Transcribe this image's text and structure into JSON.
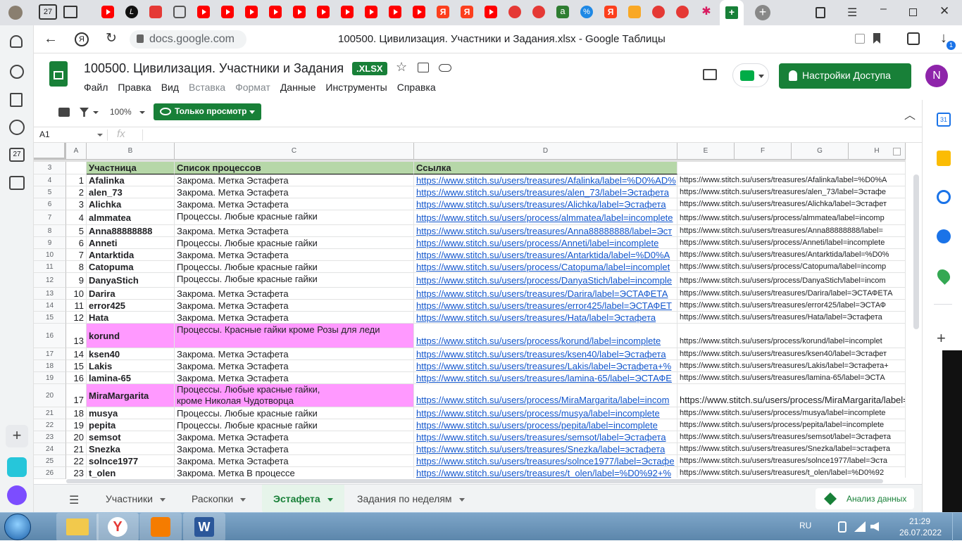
{
  "browser": {
    "tab_count_badge": "27",
    "address": "docs.google.com",
    "page_title": "100500. Цивилизация. Участники и Задания.xlsx - Google Таблицы",
    "download_badge": "1"
  },
  "doc": {
    "title": "100500. Цивилизация. Участники и Задания",
    "badge": ".XLSX",
    "menus": [
      "Файл",
      "Правка",
      "Вид",
      "Вставка",
      "Формат",
      "Данные",
      "Инструменты",
      "Справка"
    ],
    "share_label": "Настройки Доступа",
    "avatar_letter": "N",
    "colors": {
      "brand_green": "#188038",
      "link": "#1155cc",
      "header_fill": "#b6d7a8",
      "pink_fill": "#ff99ff",
      "avatar": "#8e24aa"
    }
  },
  "toolbar": {
    "zoom": "100%",
    "view_only_label": "Только просмотр",
    "cell_ref": "A1",
    "fx": "fx"
  },
  "grid": {
    "columns": [
      "A",
      "B",
      "C",
      "D",
      "E",
      "F",
      "G",
      "H"
    ],
    "header_row": {
      "num": "3",
      "b": "Участница",
      "c": "Список процессов",
      "d": "Ссылка"
    },
    "rows": [
      {
        "num": "4",
        "a": "1",
        "b": "Afalinka",
        "c": "Закрома. Метка Эстафета",
        "d": "https://www.stitch.su/users/treasures/Afalinka/label=%D0%AD%",
        "e": "https://www.stitch.su/users/treasures/Afalinka/label=%D0%A"
      },
      {
        "num": "5",
        "a": "2",
        "b": "alen_73",
        "c": "Закрома. Метка Эстафета",
        "d": "https://www.stitch.su/users/treasures/alen_73/label=Эстафета",
        "e": "https://www.stitch.su/users/treasures/alen_73/label=Эстафе"
      },
      {
        "num": "6",
        "a": "3",
        "b": "Alichka",
        "c": "Закрома. Метка Эстафета",
        "d": "https://www.stitch.su/users/treasures/Alichka/label=Эстафета",
        "e": "https://www.stitch.su/users/treasures/Alichka/label=Эстафет"
      },
      {
        "num": "7",
        "a": "4",
        "b": "almmatea",
        "c": "Процессы. Любые красные гайки",
        "d": "https://www.stitch.su/users/process/almmatea/label=incomplete",
        "e": "https://www.stitch.su/users/process/almmatea/label=incomp"
      },
      {
        "num": "8",
        "a": "5",
        "b": "Anna88888888",
        "c": "Закрома. Метка Эстафета",
        "d": "https://www.stitch.su/users/treasures/Anna88888888/label=Эст",
        "e": "https://www.stitch.su/users/treasures/Anna88888888/label="
      },
      {
        "num": "9",
        "a": "6",
        "b": "Anneti",
        "c": "Процессы. Любые красные гайки",
        "d": "https://www.stitch.su/users/process/Anneti/label=incomplete",
        "e": "https://www.stitch.su/users/process/Anneti/label=incomplete"
      },
      {
        "num": "10",
        "a": "7",
        "b": "Antarktida",
        "c": "Закрома. Метка Эстафета",
        "d": "https://www.stitch.su/users/treasures/Antarktida/label=%D0%A",
        "e": "https://www.stitch.su/users/treasures/Antarktida/label=%D0%"
      },
      {
        "num": "11",
        "a": "8",
        "b": "Catopuma",
        "c": "Процессы. Любые красные гайки",
        "d": "https://www.stitch.su/users/process/Catopuma/label=incomplet",
        "e": "https://www.stitch.su/users/process/Catopuma/label=incomp"
      },
      {
        "num": "12",
        "a": "9",
        "b": "DanyaStich",
        "c": "Процессы. Любые красные гайки",
        "d": "https://www.stitch.su/users/process/DanyaStich/label=incomple",
        "e": "https://www.stitch.su/users/process/DanyaStich/label=incom"
      },
      {
        "num": "13",
        "a": "10",
        "b": "Darira",
        "c": "Закрома. Метка Эстафета",
        "d": "https://www.stitch.su/users/treasures/Darira/label=ЭСТАФЕТА",
        "e": "https://www.stitch.su/users/treasures/Darira/label=ЭСТАФЕТА"
      },
      {
        "num": "14",
        "a": "11",
        "b": "error425",
        "c": "Закрома. Метка Эстафета",
        "d": "https://www.stitch.su/users/treasures/error425/label=ЭСТАФЕТ",
        "e": "https://www.stitch.su/users/treasures/error425/label=ЭСТАФ"
      },
      {
        "num": "15",
        "a": "12",
        "b": "Hata",
        "c": "Закрома. Метка Эстафета",
        "d": "https://www.stitch.su/users/treasures/Hata/label=Эстафета",
        "e": "https://www.stitch.su/users/treasures/Hata/label=Эстафета"
      },
      {
        "num": "16",
        "a": "13",
        "b": "korund",
        "c": "Процессы. Красные гайки кроме Розы для леди",
        "d": "https://www.stitch.su/users/process/korund/label=incomplete",
        "e": "https://www.stitch.su/users/process/korund/label=incomplet"
      },
      {
        "num": "17",
        "a": "14",
        "b": "ksen40",
        "c": "Закрома. Метка Эстафета",
        "d": "https://www.stitch.su/users/treasures/ksen40/label=Эстафета",
        "e": "https://www.stitch.su/users/treasures/ksen40/label=Эстафет"
      },
      {
        "num": "18",
        "a": "15",
        "b": "Lakis",
        "c": "Закрома. Метка Эстафета",
        "d": "https://www.stitch.su/users/treasures/Lakis/label=Эстафета+%",
        "e": "https://www.stitch.su/users/treasures/Lakis/label=Эстафета+"
      },
      {
        "num": "19",
        "a": "16",
        "b": "lamina-65",
        "c": "Закрома. Метка Эстафета",
        "d": "https://www.stitch.su/users/treasures/lamina-65/label=ЭСТАФЕ",
        "e": "https://www.stitch.su/users/treasures/lamina-65/label=ЭСТА"
      },
      {
        "num": "20",
        "a": "17",
        "b": "MiraMargarita",
        "c": "Процессы. Любые красные гайки,",
        "c2": "кроме Николая Чудотворца",
        "d": "https://www.stitch.su/users/process/MiraMargarita/label=incom",
        "e": "https://www.stitch.su/users/process/MiraMargarita/label="
      },
      {
        "num": "21",
        "a": "18",
        "b": "musya",
        "c": "Процессы. Любые красные гайки",
        "d": "https://www.stitch.su/users/process/musya/label=incomplete",
        "e": "https://www.stitch.su/users/process/musya/label=incomplete"
      },
      {
        "num": "22",
        "a": "19",
        "b": "pepita",
        "c": "Процессы. Любые красные гайки",
        "d": "https://www.stitch.su/users/process/pepita/label=incomplete",
        "e": "https://www.stitch.su/users/process/pepita/label=incomplete"
      },
      {
        "num": "23",
        "a": "20",
        "b": "semsot",
        "c": "Закрома. Метка Эстафета",
        "d": "https://www.stitch.su/users/treasures/semsot/label=Эстафета",
        "e": "https://www.stitch.su/users/treasures/semsot/label=Эстафета"
      },
      {
        "num": "24",
        "a": "21",
        "b": "Snezka",
        "c": "Закрома. Метка Эстафета",
        "d": "https://www.stitch.su/users/treasures/Snezka/label=эстафета",
        "e": "https://www.stitch.su/users/treasures/Snezka/label=эстафета"
      },
      {
        "num": "25",
        "a": "22",
        "b": "solnce1977",
        "c": "Закрома. Метка Эстафета",
        "d": "https://www.stitch.su/users/treasures/solnce1977/label=Эстафе",
        "e": "https://www.stitch.su/users/treasures/solnce1977/label=Эста"
      },
      {
        "num": "26",
        "a": "23",
        "b": "t_olen",
        "c": "Закрома. Метка В процессе",
        "d": "https://www.stitch.su/users/treasures/t_olen/label=%D0%92+%",
        "e": "https://www.stitch.su/users/treasures/t_olen/label=%D0%92"
      }
    ]
  },
  "sheets": {
    "tabs": [
      "Участники",
      "Раскопки",
      "Эстафета",
      "Задания по неделям"
    ],
    "active": "Эстафета",
    "explore_label": "Анализ данных"
  },
  "taskbar": {
    "lang": "RU",
    "time": "21:29",
    "date": "26.07.2022"
  }
}
